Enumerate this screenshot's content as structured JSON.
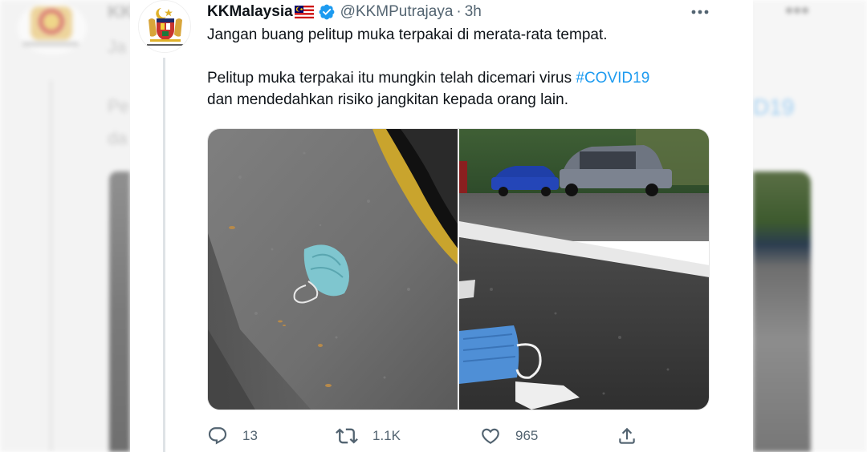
{
  "tweet": {
    "display_name": "KKMalaysia",
    "handle": "@KKMPutrajaya",
    "separator": "·",
    "time": "3h",
    "text_line1": "Jangan buang pelitup muka terpakai di merata-rata tempat.",
    "text_line2": "Pelitup muka terpakai itu mungkin telah dicemari virus ",
    "hashtag": "#COVID19",
    "text_line3": "dan mendedahkan risiko jangkitan kepada orang lain."
  },
  "actions": {
    "reply_count": "13",
    "retweet_count": "1.1K",
    "like_count": "965"
  },
  "backdrop": {
    "left_fragment_1": "KK",
    "left_fragment_2": "Ja",
    "left_fragment_3": "Pe",
    "left_fragment_4": "da",
    "right_fragment": "D19"
  },
  "icons": {
    "more": "more-dots-icon",
    "verified": "verified-badge-icon",
    "flag": "malaysia-flag-icon",
    "reply": "reply-icon",
    "retweet": "retweet-icon",
    "like": "heart-icon",
    "share": "share-icon"
  },
  "colors": {
    "link": "#1d9bf0",
    "secondary_text": "#536471",
    "primary_text": "#0f1419"
  }
}
